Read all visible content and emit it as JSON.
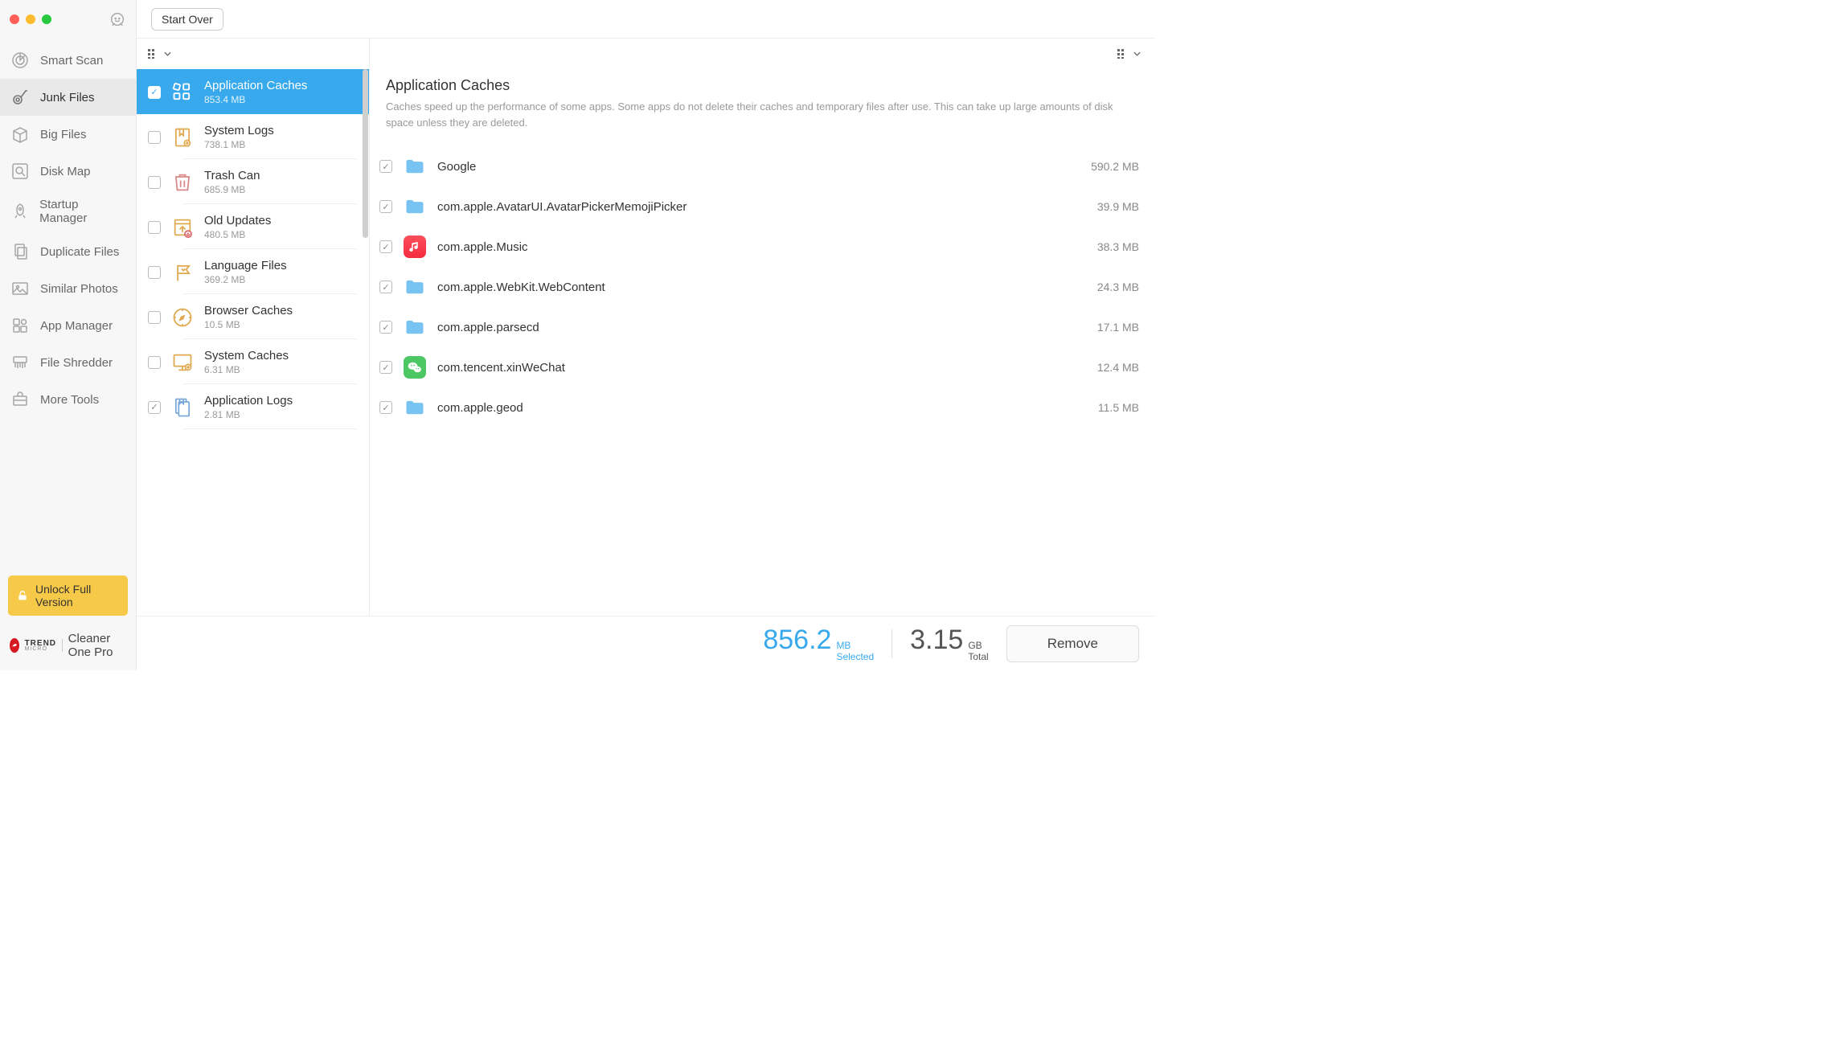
{
  "header": {
    "start_over": "Start Over"
  },
  "sidebar": {
    "items": [
      {
        "label": "Smart Scan"
      },
      {
        "label": "Junk Files"
      },
      {
        "label": "Big Files"
      },
      {
        "label": "Disk Map"
      },
      {
        "label": "Startup Manager"
      },
      {
        "label": "Duplicate Files"
      },
      {
        "label": "Similar Photos"
      },
      {
        "label": "App Manager"
      },
      {
        "label": "File Shredder"
      },
      {
        "label": "More Tools"
      }
    ],
    "unlock": "Unlock Full Version",
    "brand_line1": "TREND",
    "brand_line2": "MICRO",
    "product": "Cleaner One Pro"
  },
  "categories": [
    {
      "title": "Application Caches",
      "size": "853.4 MB",
      "checked": true,
      "selected": true,
      "icon": "grid"
    },
    {
      "title": "System Logs",
      "size": "738.1 MB",
      "checked": false,
      "icon": "bookmark"
    },
    {
      "title": "Trash Can",
      "size": "685.9 MB",
      "checked": false,
      "icon": "trash"
    },
    {
      "title": "Old Updates",
      "size": "480.5 MB",
      "checked": false,
      "icon": "update"
    },
    {
      "title": "Language Files",
      "size": "369.2 MB",
      "checked": false,
      "icon": "flag"
    },
    {
      "title": "Browser Caches",
      "size": "10.5 MB",
      "checked": false,
      "icon": "compass"
    },
    {
      "title": "System Caches",
      "size": "6.31 MB",
      "checked": false,
      "icon": "monitor"
    },
    {
      "title": "Application Logs",
      "size": "2.81 MB",
      "checked": true,
      "icon": "doc"
    }
  ],
  "detail": {
    "title": "Application Caches",
    "desc": "Caches speed up the performance of some apps. Some apps do not delete their caches and temporary files after use. This can take up large amounts of disk space unless they are deleted.",
    "items": [
      {
        "name": "Google",
        "size": "590.2 MB",
        "checked": true,
        "icon": "folder"
      },
      {
        "name": "com.apple.AvatarUI.AvatarPickerMemojiPicker",
        "size": "39.9 MB",
        "checked": true,
        "icon": "folder"
      },
      {
        "name": "com.apple.Music",
        "size": "38.3 MB",
        "checked": true,
        "icon": "music"
      },
      {
        "name": "com.apple.WebKit.WebContent",
        "size": "24.3 MB",
        "checked": true,
        "icon": "folder"
      },
      {
        "name": "com.apple.parsecd",
        "size": "17.1 MB",
        "checked": true,
        "icon": "folder"
      },
      {
        "name": "com.tencent.xinWeChat",
        "size": "12.4 MB",
        "checked": true,
        "icon": "wechat"
      },
      {
        "name": "com.apple.geod",
        "size": "11.5 MB",
        "checked": true,
        "icon": "folder"
      }
    ]
  },
  "footer": {
    "selected_value": "856.2",
    "selected_unit": "MB",
    "selected_label": "Selected",
    "total_value": "3.15",
    "total_unit": "GB",
    "total_label": "Total",
    "remove": "Remove"
  }
}
